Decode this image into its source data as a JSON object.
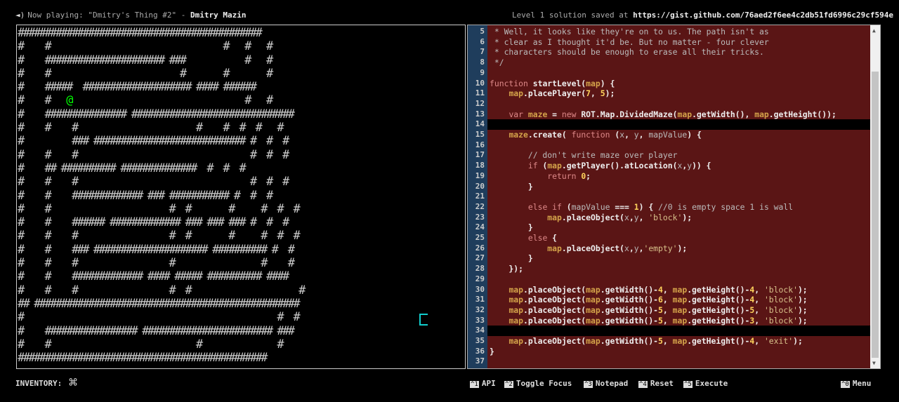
{
  "top_bar": {
    "speaker_icon": "speaker-icon",
    "now_playing_prefix": "Now playing: \"Dmitry's Thing #2\" - ",
    "now_playing_artist": "Dmitry Mazin",
    "solution_prefix": "Level 1 solution saved at ",
    "solution_url": "https://gist.github.com/76aed2f6ee4c2db51fd6996c29cf594e"
  },
  "map": {
    "rows": [
      "#############################################",
      "#    #                                #   #   #",
      "#    ###################### ###           #   #",
      "#    #                        #       #       #",
      "#    #####  #################### #### ######",
      "#    #   @                                #   #",
      "#    ############### ##############################",
      "#    #    #                      #    #  #  #   #",
      "#         ### ############################ #  #  #",
      "#    #    #                                #  #  #",
      "#    ## ########## ##############  #  #  #",
      "#    #    #                                #  #  #",
      "#    #    ############# ### ########### #  #  #",
      "#    #                      #  #       #     #  #  #",
      "#    #    ###### ############# ### ### ### #  #  #",
      "#    #    #                 #  #       #     #  #  #",
      "#    #    ### ##################### ########## #  #",
      "#    #    #                 #                #    #",
      "#    #    ############# #### ##### ########## ####",
      "#    #    #                 #  #                    #",
      "## #################################################",
      "#                                               #  #",
      "#    ################# ######################## ###",
      "#    #                           #              #",
      "##############################################"
    ],
    "player_glyph": "@"
  },
  "editor": {
    "lines": [
      {
        "n": "5",
        "t": " * Well, it looks like they're on to us. The path isn't as",
        "cls": "cmt"
      },
      {
        "n": "6",
        "t": " * clear as I thought it'd be. But no matter - four clever",
        "cls": "cmt"
      },
      {
        "n": "7",
        "t": " * characters should be enough to erase all their tricks.",
        "cls": "cmt"
      },
      {
        "n": "8",
        "t": " */",
        "cls": "cmt"
      },
      {
        "n": "9",
        "t": "",
        "cls": ""
      },
      {
        "n": "10",
        "t": "function startLevel(map) {",
        "cls": ""
      },
      {
        "n": "11",
        "t": "    map.placePlayer(7, 5);",
        "cls": ""
      },
      {
        "n": "12",
        "t": "",
        "cls": ""
      },
      {
        "n": "13",
        "t": "    var maze = new ROT.Map.DividedMaze(map.getWidth(), map.getHeight());",
        "cls": ""
      },
      {
        "n": "14",
        "t": "",
        "cls": "",
        "editable": true
      },
      {
        "n": "15",
        "t": "    maze.create( function (x, y, mapValue) {",
        "cls": ""
      },
      {
        "n": "16",
        "t": "",
        "cls": ""
      },
      {
        "n": "17",
        "t": "        // don't write maze over player",
        "cls": "cmt"
      },
      {
        "n": "18",
        "t": "        if (map.getPlayer().atLocation(x,y)) {",
        "cls": ""
      },
      {
        "n": "19",
        "t": "            return 0;",
        "cls": ""
      },
      {
        "n": "20",
        "t": "        }",
        "cls": ""
      },
      {
        "n": "21",
        "t": "",
        "cls": ""
      },
      {
        "n": "22",
        "t": "        else if (mapValue === 1) { //0 is empty space 1 is wall",
        "cls": ""
      },
      {
        "n": "23",
        "t": "            map.placeObject(x,y, 'block');",
        "cls": ""
      },
      {
        "n": "24",
        "t": "        }",
        "cls": ""
      },
      {
        "n": "25",
        "t": "        else {",
        "cls": ""
      },
      {
        "n": "26",
        "t": "            map.placeObject(x,y,'empty');",
        "cls": ""
      },
      {
        "n": "27",
        "t": "        }",
        "cls": ""
      },
      {
        "n": "28",
        "t": "    });",
        "cls": ""
      },
      {
        "n": "29",
        "t": "",
        "cls": ""
      },
      {
        "n": "30",
        "t": "    map.placeObject(map.getWidth()-4, map.getHeight()-4, 'block');",
        "cls": ""
      },
      {
        "n": "31",
        "t": "    map.placeObject(map.getWidth()-6, map.getHeight()-4, 'block');",
        "cls": ""
      },
      {
        "n": "32",
        "t": "    map.placeObject(map.getWidth()-5, map.getHeight()-5, 'block');",
        "cls": ""
      },
      {
        "n": "33",
        "t": "    map.placeObject(map.getWidth()-5, map.getHeight()-3, 'block');",
        "cls": ""
      },
      {
        "n": "34",
        "t": "",
        "cls": "",
        "editable": true
      },
      {
        "n": "35",
        "t": "    map.placeObject(map.getWidth()-5, map.getHeight()-4, 'exit');",
        "cls": ""
      },
      {
        "n": "36",
        "t": "}",
        "cls": ""
      },
      {
        "n": "37",
        "t": "",
        "cls": ""
      }
    ]
  },
  "bottom_bar": {
    "inventory_label": "INVENTORY:",
    "inventory_icon": "command-key-icon",
    "hotkeys": [
      {
        "key": "^1",
        "label": "API"
      },
      {
        "key": "^2",
        "label": "Toggle Focus"
      },
      {
        "key": "^3",
        "label": "Notepad"
      },
      {
        "key": "^4",
        "label": "Reset"
      },
      {
        "key": "^5",
        "label": "Execute"
      }
    ],
    "menu": {
      "key": "^0",
      "label": "Menu"
    }
  }
}
